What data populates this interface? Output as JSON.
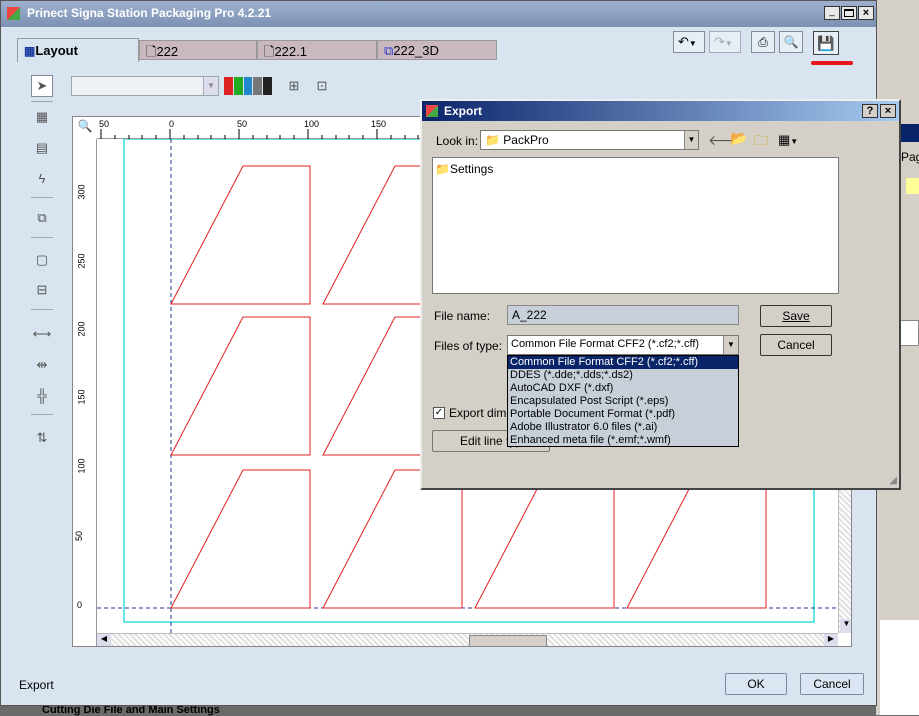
{
  "window": {
    "title": "Prinect Signa Station Packaging Pro 4.2.21"
  },
  "tabs": [
    {
      "label": "Layout",
      "active": true
    },
    {
      "label": "222"
    },
    {
      "label": "222.1"
    },
    {
      "label": "222_3D"
    }
  ],
  "rulers": {
    "h": [
      "50",
      "0",
      "50",
      "100",
      "150"
    ],
    "v": [
      "300",
      "250",
      "200",
      "150",
      "100",
      "50",
      "0"
    ]
  },
  "status": {
    "label": "Export"
  },
  "main_buttons": {
    "ok": "OK",
    "cancel": "Cancel"
  },
  "behind": {
    "text": "Cutting Die File and Main Settings",
    "pag": "Pag"
  },
  "dialog": {
    "title": "Export",
    "help": "?",
    "look_in_label": "Look in:",
    "look_in_value": "PackPro",
    "files": [
      "Settings"
    ],
    "file_name_label": "File name:",
    "file_name_value": "A_222",
    "files_of_type_label": "Files of type:",
    "files_of_type_value": "Common File Format CFF2 (*.cf2;*.cff)",
    "type_options": [
      "Common File Format CFF2 (*.cf2;*.cff)",
      "DDES (*.dde;*.dds;*.ds2)",
      "AutoCAD DXF (*.dxf)",
      "Encapsulated Post Script (*.eps)",
      "Portable Document Format (*.pdf)",
      "Adobe Illustrator 6.0 files (*.ai)",
      "Enhanced meta file (*.emf;*.wmf)"
    ],
    "save": "Save",
    "cancel": "Cancel",
    "export_dims": "Export dimen",
    "edit_line": "Edit line typ"
  },
  "colors": {
    "title_bar": "#8a9fbf",
    "dialog_title": "#0a246a",
    "selected": "#0a246a",
    "shape": "#e02020",
    "guide": "#33dddd"
  }
}
